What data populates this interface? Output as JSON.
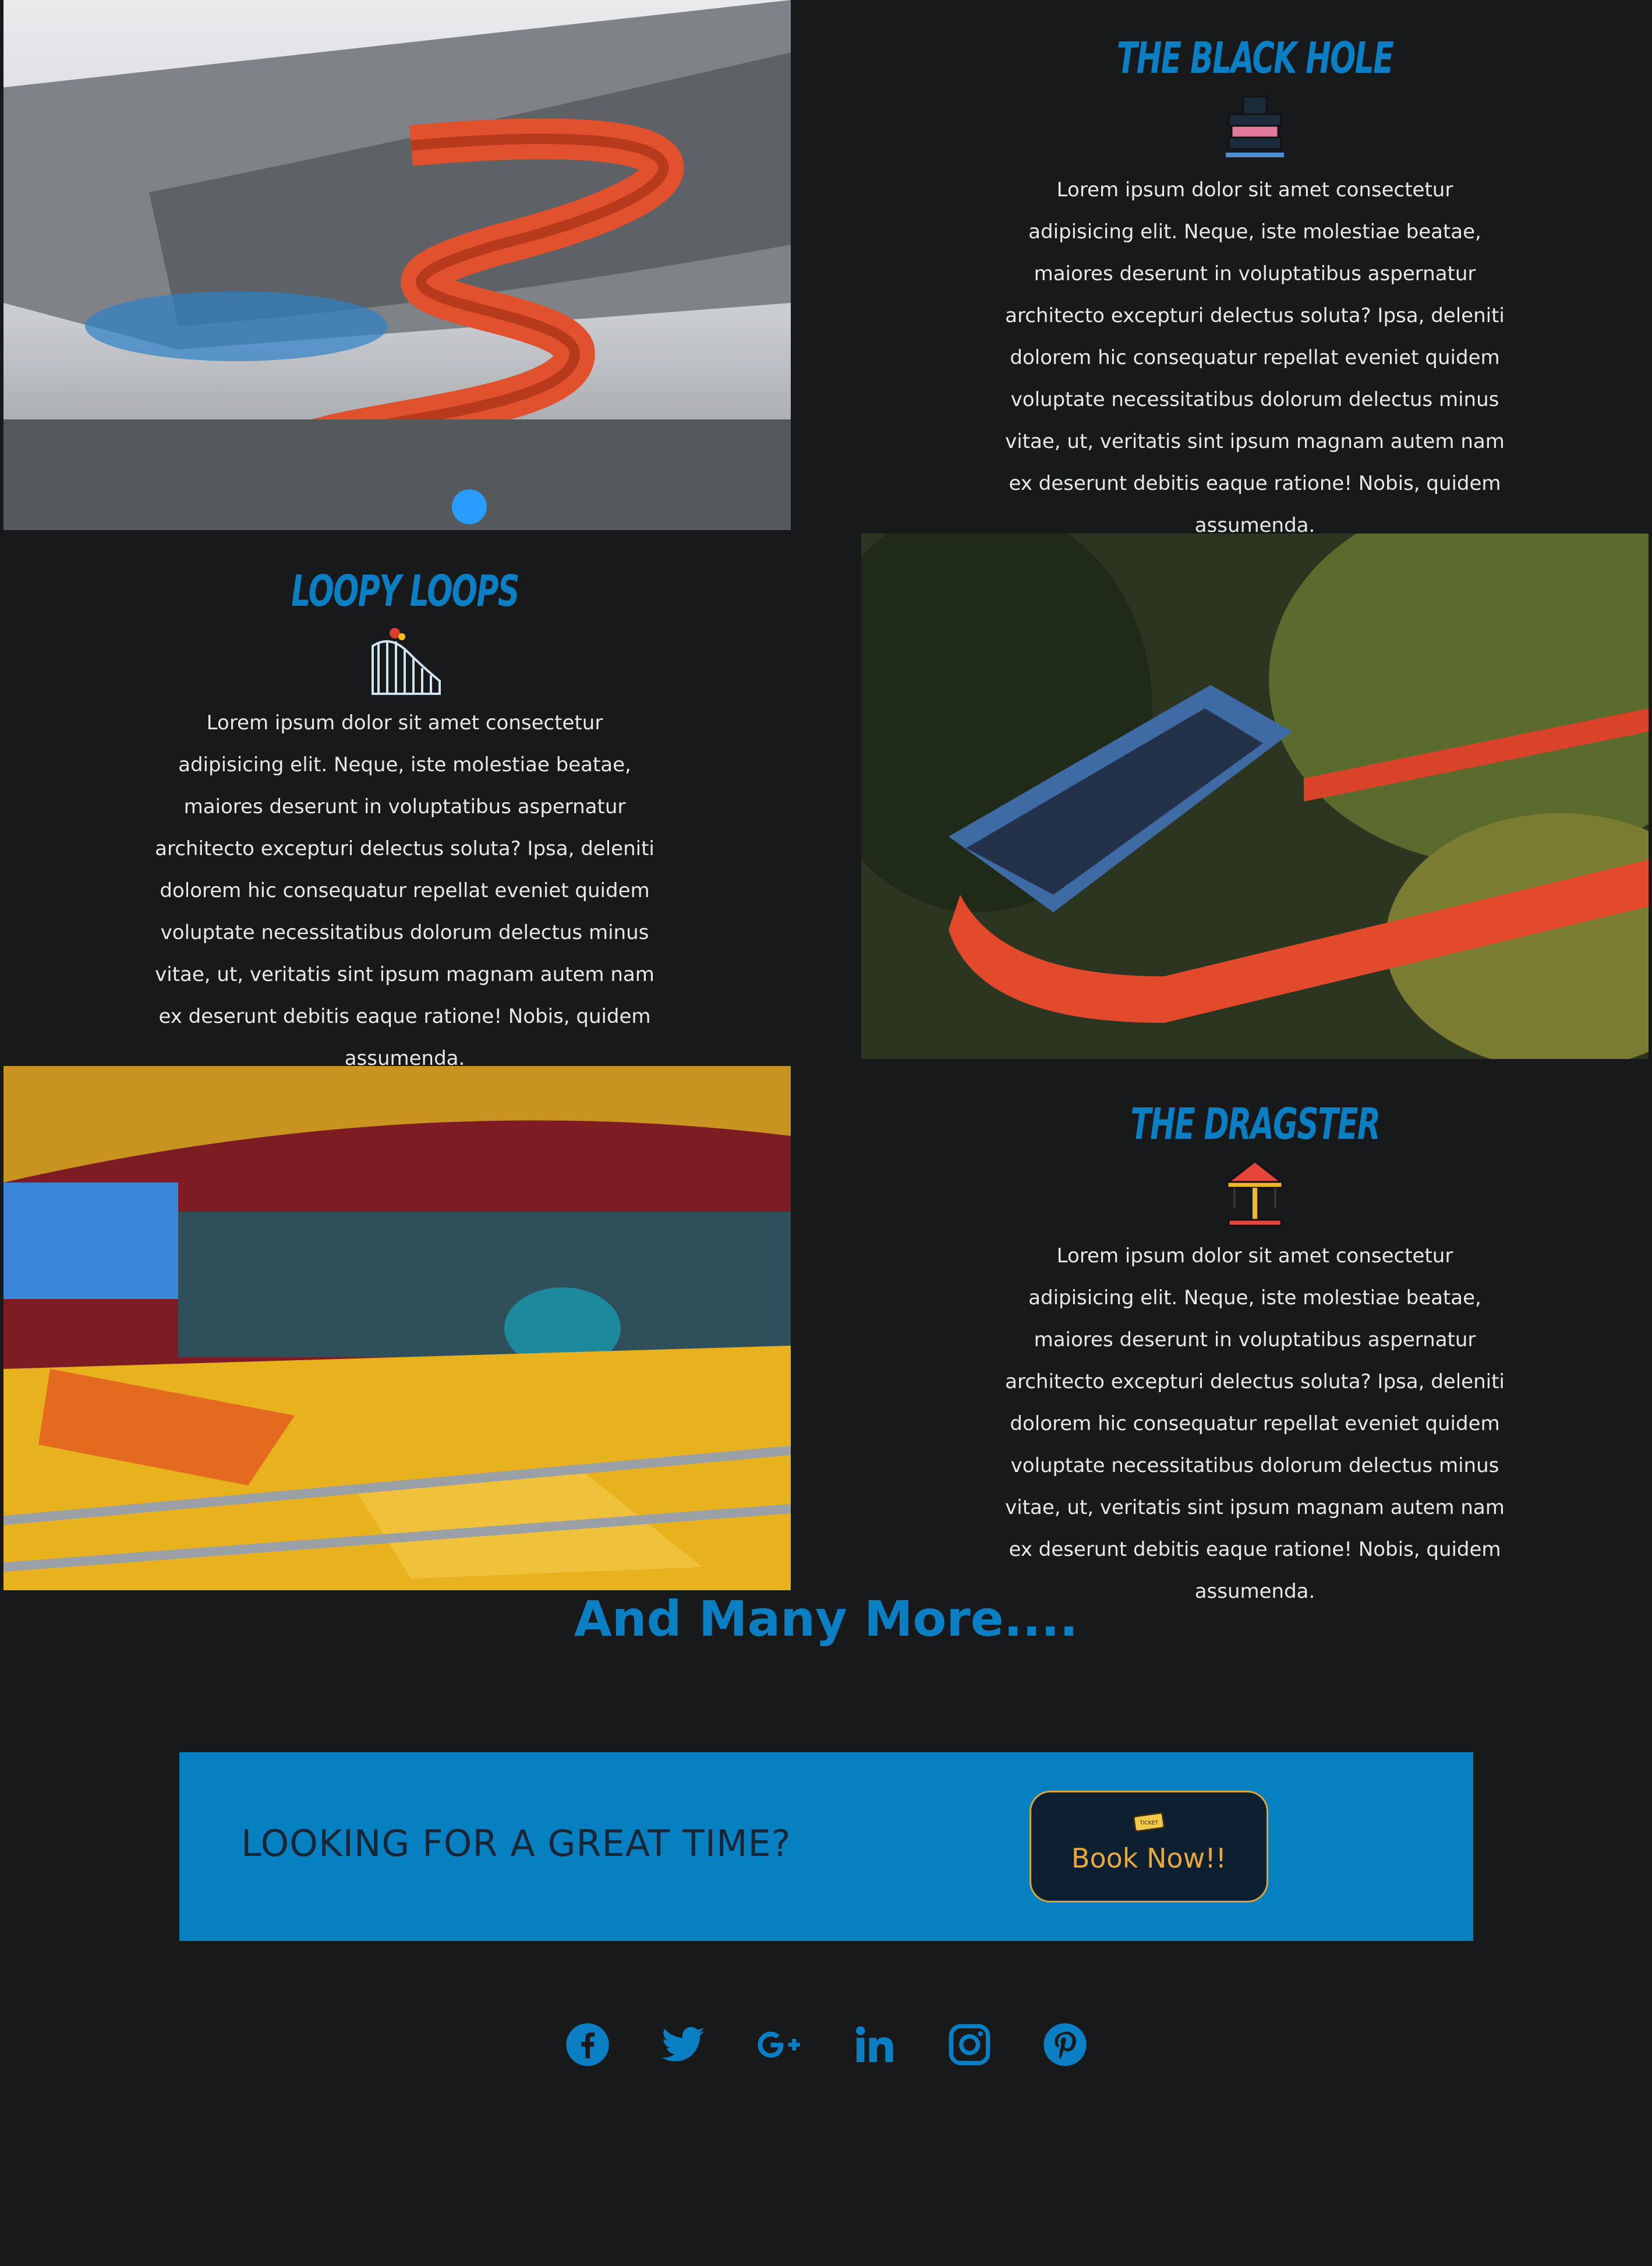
{
  "rides": [
    {
      "title": "THE BLACK HOLE",
      "icon": "water-slide-icon",
      "description": "Lorem ipsum dolor sit amet consectetur adipisicing elit. Neque, iste molestiae beatae, maiores deserunt in voluptatibus aspernatur architecto excepturi delectus soluta? Ipsa, deleniti dolorem hic consequatur repellat eveniet quidem voluptate necessitatibus dolorum delectus minus vitae, ut, veritatis sint ipsum magnam autem nam ex deserunt debitis eaque ratione! Nobis, quidem assumenda."
    },
    {
      "title": "LOOPY LOOPS",
      "icon": "roller-coaster-icon",
      "description": "Lorem ipsum dolor sit amet consectetur adipisicing elit. Neque, iste molestiae beatae, maiores deserunt in voluptatibus aspernatur architecto excepturi delectus soluta? Ipsa, deleniti dolorem hic consequatur repellat eveniet quidem voluptate necessitatibus dolorum delectus minus vitae, ut, veritatis sint ipsum magnam autem nam ex deserunt debitis eaque ratione! Nobis, quidem assumenda."
    },
    {
      "title": "THE DRAGSTER",
      "icon": "carousel-icon",
      "description": "Lorem ipsum dolor sit amet consectetur adipisicing elit. Neque, iste molestiae beatae, maiores deserunt in voluptatibus aspernatur architecto excepturi delectus soluta? Ipsa, deleniti dolorem hic consequatur repellat eveniet quidem voluptate necessitatibus dolorum delectus minus vitae, ut, veritatis sint ipsum magnam autem nam ex deserunt debitis eaque ratione! Nobis, quidem assumenda."
    }
  ],
  "more_heading": "And Many More....",
  "cta": {
    "text": "LOOKING FOR A GREAT TIME?",
    "button_label": "Book Now!!",
    "button_icon": "ticket-icon",
    "ticket_text": "TICKET"
  },
  "social": [
    "facebook-icon",
    "twitter-icon",
    "google-plus-icon",
    "linkedin-icon",
    "instagram-icon",
    "pinterest-icon"
  ],
  "colors": {
    "background": "#18191b",
    "accent": "#0b7fc4",
    "cta_band": "#0680c1",
    "button_bg": "#0d2031",
    "button_text": "#e9a83a"
  }
}
